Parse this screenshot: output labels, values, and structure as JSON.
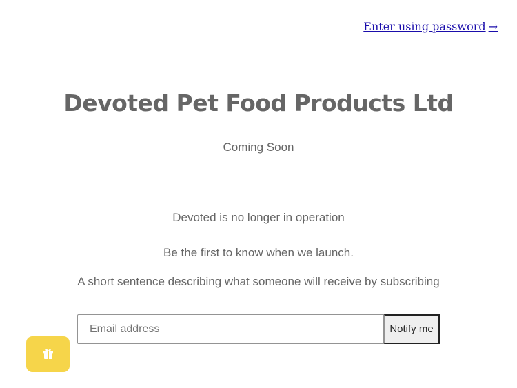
{
  "header": {
    "password_link_label": "Enter using password",
    "password_link_arrow": "→"
  },
  "main": {
    "store_name": "Devoted Pet Food Products Ltd",
    "coming_soon": "Coming Soon",
    "notice": "Devoted is no longer in operation",
    "launch_text": "Be the first to know when we launch.",
    "subscribe_description": "A short sentence describing what someone will receive by subscribing"
  },
  "signup": {
    "email_placeholder": "Email address",
    "email_value": "",
    "submit_label": "Notify me"
  },
  "widget": {
    "icon": "gift-icon",
    "color": "#f6d54a"
  },
  "colors": {
    "text": "#666666",
    "link": "#1a0dab",
    "accent": "#f6d54a"
  }
}
